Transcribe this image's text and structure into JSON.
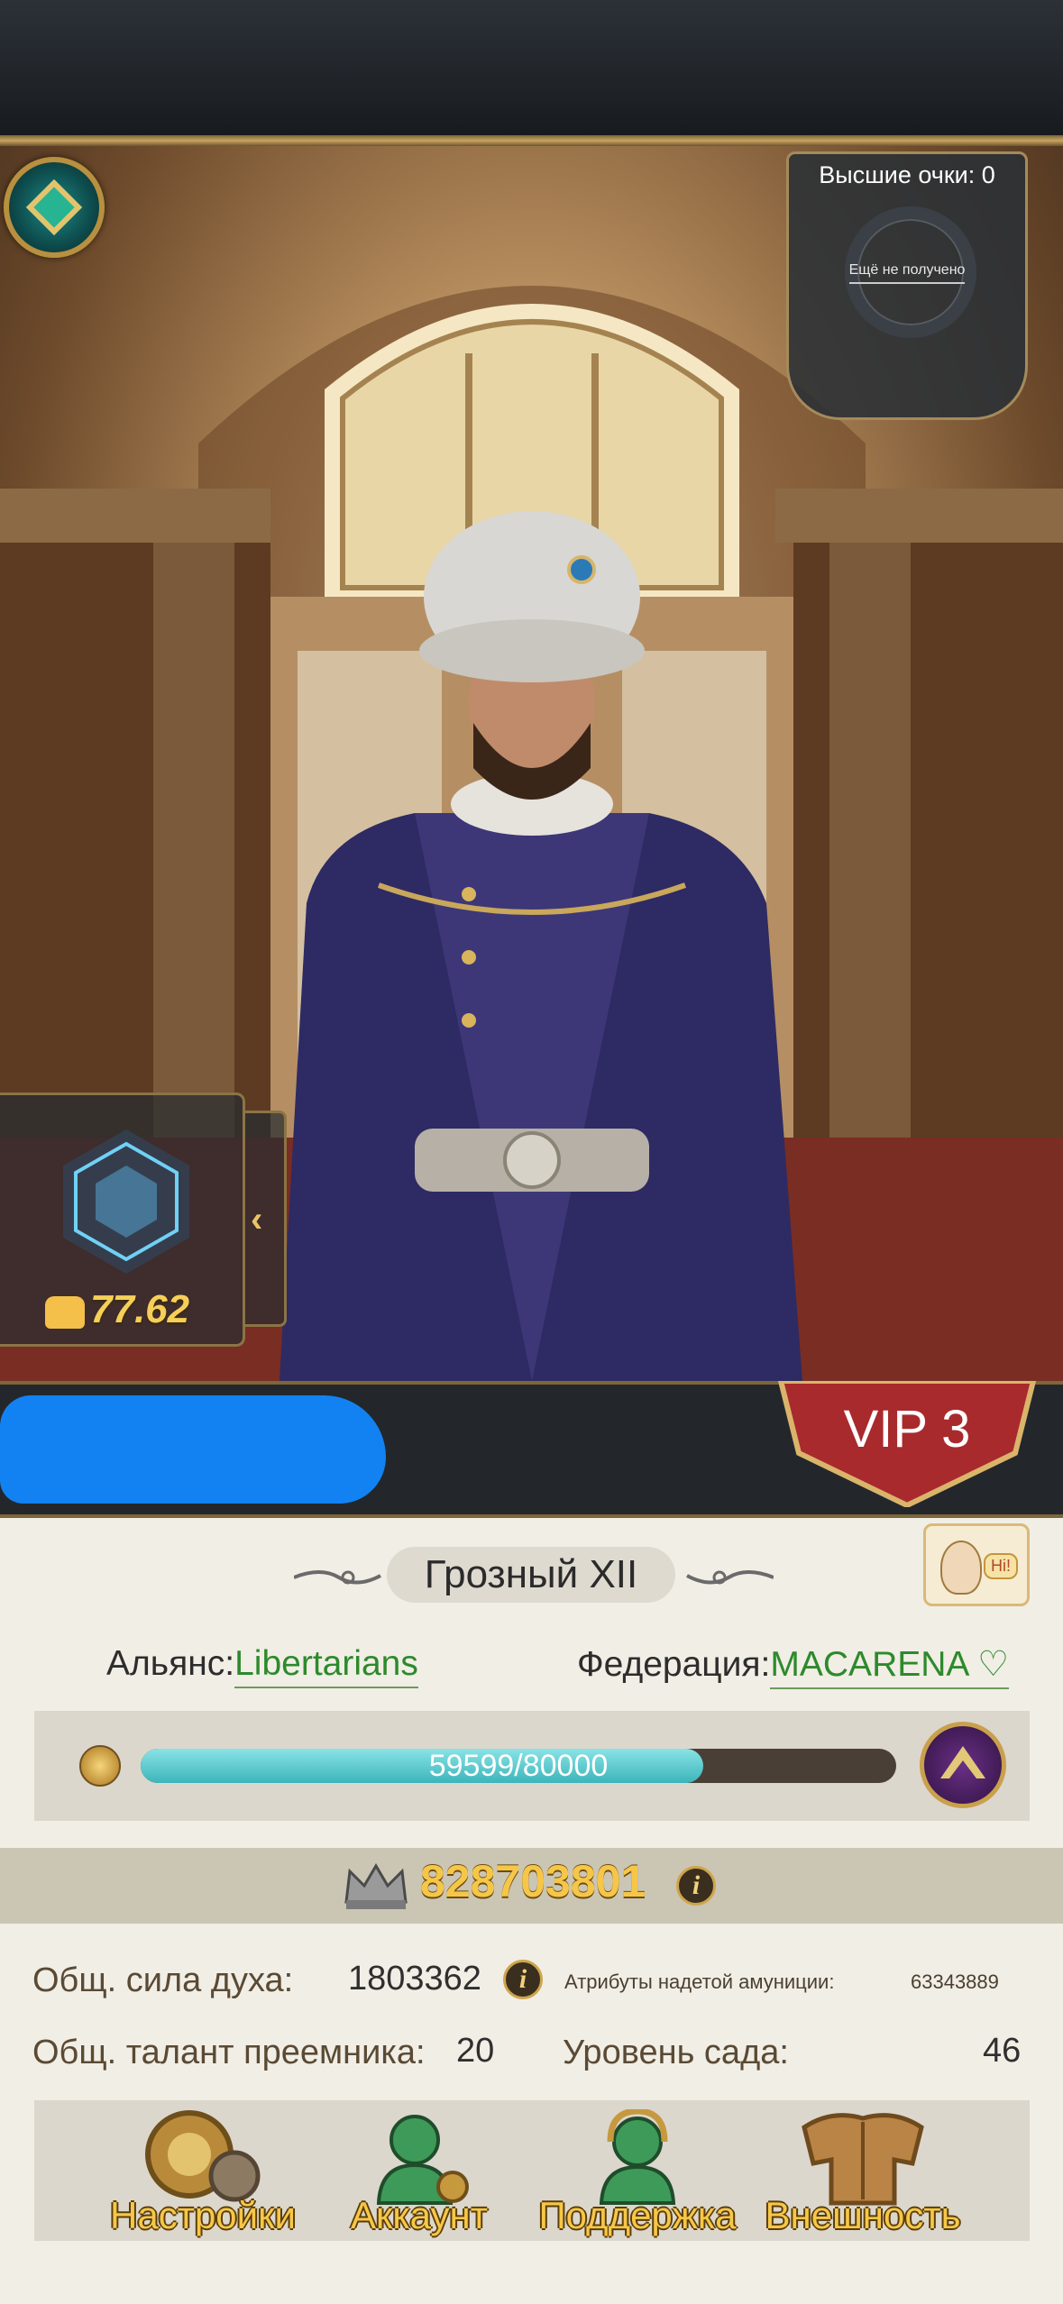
{
  "header": {
    "title": ""
  },
  "score_panel": {
    "title": "Высшие очки: 0",
    "status": "Ещё не получено"
  },
  "power": {
    "value": "77.62"
  },
  "vip": {
    "label": "VIP 3"
  },
  "profile": {
    "name": "Грозный XII",
    "alliance_label": "Альянс:",
    "alliance_value": "Libertarians",
    "federation_label": "Федерация:",
    "federation_value": "MACARENA ♡",
    "hi_label": "Hi!"
  },
  "experience": {
    "text": "59599/80000",
    "current": 59599,
    "max": 80000
  },
  "total_power": {
    "value": "828703801"
  },
  "stats": {
    "spirit_label": "Общ. сила духа:",
    "spirit_value": "1803362",
    "gear_label": "Атрибуты надетой амуниции:",
    "gear_value": "63343889",
    "heir_label": "Общ. талант преемника:",
    "heir_value": "20",
    "garden_label": "Уровень сада:",
    "garden_value": "46"
  },
  "bottom_buttons": [
    {
      "label": "Настройки",
      "icon": "settings-gear-icon"
    },
    {
      "label": "Аккаунт",
      "icon": "account-icon"
    },
    {
      "label": "Поддержка",
      "icon": "support-headset-icon"
    },
    {
      "label": "Внешность",
      "icon": "appearance-armor-icon"
    }
  ],
  "colors": {
    "accent_gold": "#f6c748",
    "link_green": "#2d8a2b",
    "xp_fill": "#3cb5ba",
    "vip_red": "#a82a2d",
    "redaction_blue": "#1282f2"
  }
}
